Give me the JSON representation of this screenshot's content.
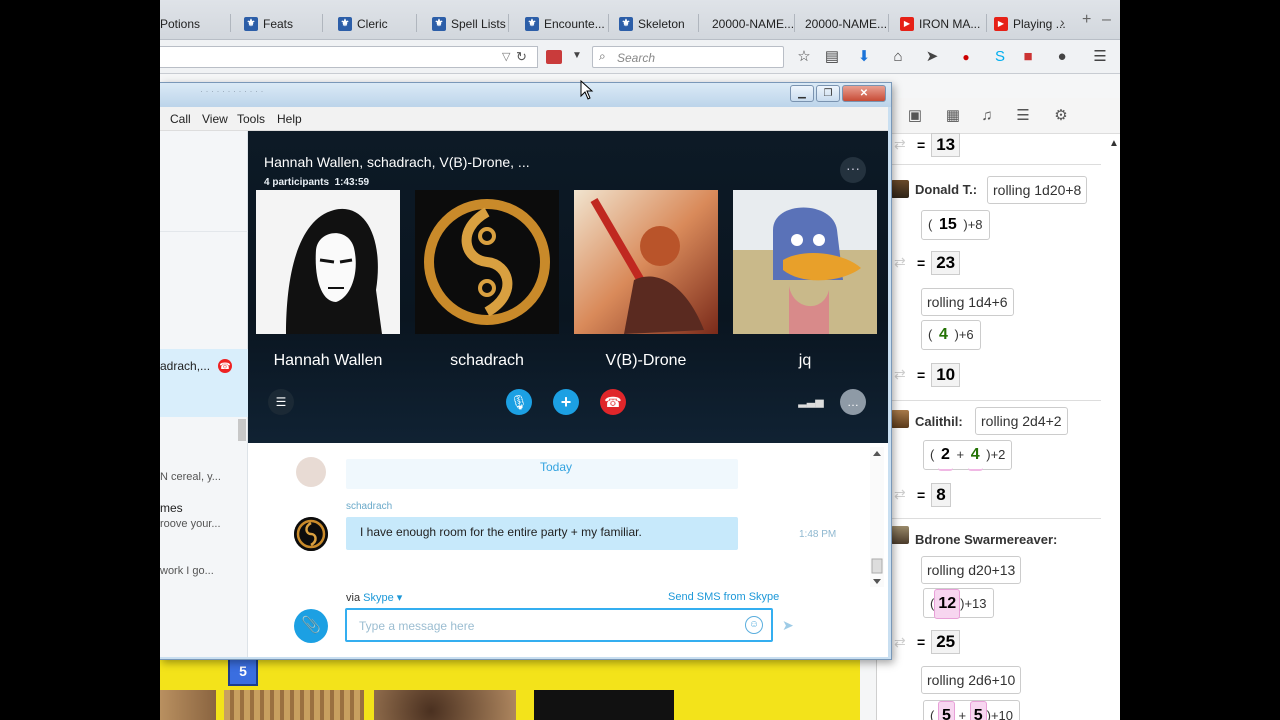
{
  "browser": {
    "bookmarks": [
      {
        "label": "Potions",
        "icon": "dnd-icon"
      },
      {
        "label": "Feats",
        "icon": "dnd-icon"
      },
      {
        "label": "Cleric",
        "icon": "dnd-icon"
      },
      {
        "label": "Spell Lists",
        "icon": "dnd-icon"
      },
      {
        "label": "Encounte...",
        "icon": "dnd-icon"
      },
      {
        "label": "Skeleton",
        "icon": "dnd-icon"
      },
      {
        "label": "20000-NAME...",
        "icon": "blank-icon"
      },
      {
        "label": "20000-NAME...",
        "icon": "blank-icon"
      },
      {
        "label": "IRON MA...",
        "icon": "youtube-icon"
      },
      {
        "label": "Playing ...",
        "icon": "youtube-icon"
      }
    ],
    "search_placeholder": "Search"
  },
  "skype": {
    "menu": [
      "Call",
      "View",
      "Tools",
      "Help"
    ],
    "sidebar": {
      "selected_contact": "adrach,...",
      "badge": "●",
      "items": [
        {
          "head": "",
          "preview": "N cereal, y..."
        },
        {
          "head": "mes",
          "preview": "roove your..."
        },
        {
          "head": "",
          "preview": "work I go..."
        }
      ]
    },
    "call": {
      "title": "Hannah Wallen, schadrach, V(B)-Drone, ...",
      "participants": "4 participants",
      "duration": "1:43:59",
      "people": [
        {
          "name": "Hannah Wallen"
        },
        {
          "name": "schadrach"
        },
        {
          "name": "V(B)-Drone"
        },
        {
          "name": "jq"
        }
      ]
    },
    "conversation": {
      "day_separator": "Today",
      "sender": "schadrach",
      "message": "I have enough room for the entire party + my familiar.",
      "time": "1:48 PM",
      "via_label": "via",
      "via_service": "Skype",
      "sms_link": "Send SMS from Skype",
      "input_placeholder": "Type a message here"
    }
  },
  "roll20": {
    "entries": [
      {
        "kind": "total",
        "value": "13"
      },
      {
        "kind": "speaker",
        "name": "Donald T.:",
        "roll": "rolling 1d20+8"
      },
      {
        "kind": "result",
        "dice": [
          "15"
        ],
        "mod": ")+8"
      },
      {
        "kind": "total",
        "value": "23"
      },
      {
        "kind": "roll",
        "roll": "rolling 1d4+6"
      },
      {
        "kind": "result",
        "dice": [
          "4"
        ],
        "mod": ")+6"
      },
      {
        "kind": "total",
        "value": "10"
      },
      {
        "kind": "speaker",
        "name": "Calithil:",
        "roll": "rolling 2d4+2"
      },
      {
        "kind": "result",
        "dice": [
          "2",
          "4"
        ],
        "mod": ")+2"
      },
      {
        "kind": "total",
        "value": "8"
      },
      {
        "kind": "speaker",
        "name": "Bdrone Swarmereaver:",
        "roll": ""
      },
      {
        "kind": "roll",
        "roll": "rolling d20+13"
      },
      {
        "kind": "result",
        "dice": [
          "12"
        ],
        "mod": ")+13"
      },
      {
        "kind": "total",
        "value": "25"
      },
      {
        "kind": "roll",
        "roll": "rolling 2d6+10"
      },
      {
        "kind": "result",
        "dice": [
          "5",
          "5"
        ],
        "mod": ")+10"
      }
    ],
    "equals": "=",
    "open_paren": "(",
    "plus": "+"
  },
  "map": {
    "token_label": "5"
  }
}
